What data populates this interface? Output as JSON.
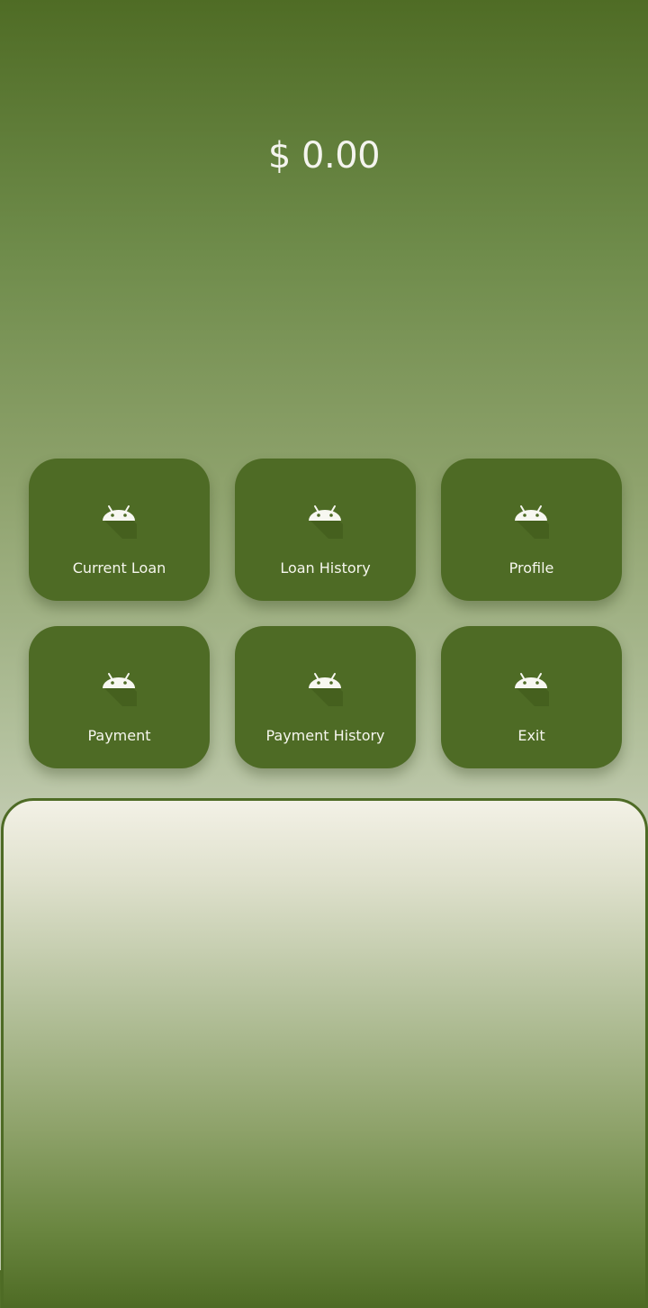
{
  "balance": "$ 0.00",
  "tiles": [
    {
      "label": "Current Loan",
      "icon": "android-icon"
    },
    {
      "label": "Loan History",
      "icon": "android-icon"
    },
    {
      "label": "Profile",
      "icon": "android-icon"
    },
    {
      "label": "Payment",
      "icon": "android-icon"
    },
    {
      "label": "Payment History",
      "icon": "android-icon"
    },
    {
      "label": "Exit",
      "icon": "android-icon"
    }
  ],
  "colors": {
    "tile": "#4e6b25",
    "header_top": "#4f6c25",
    "text": "#f6f6ee"
  }
}
